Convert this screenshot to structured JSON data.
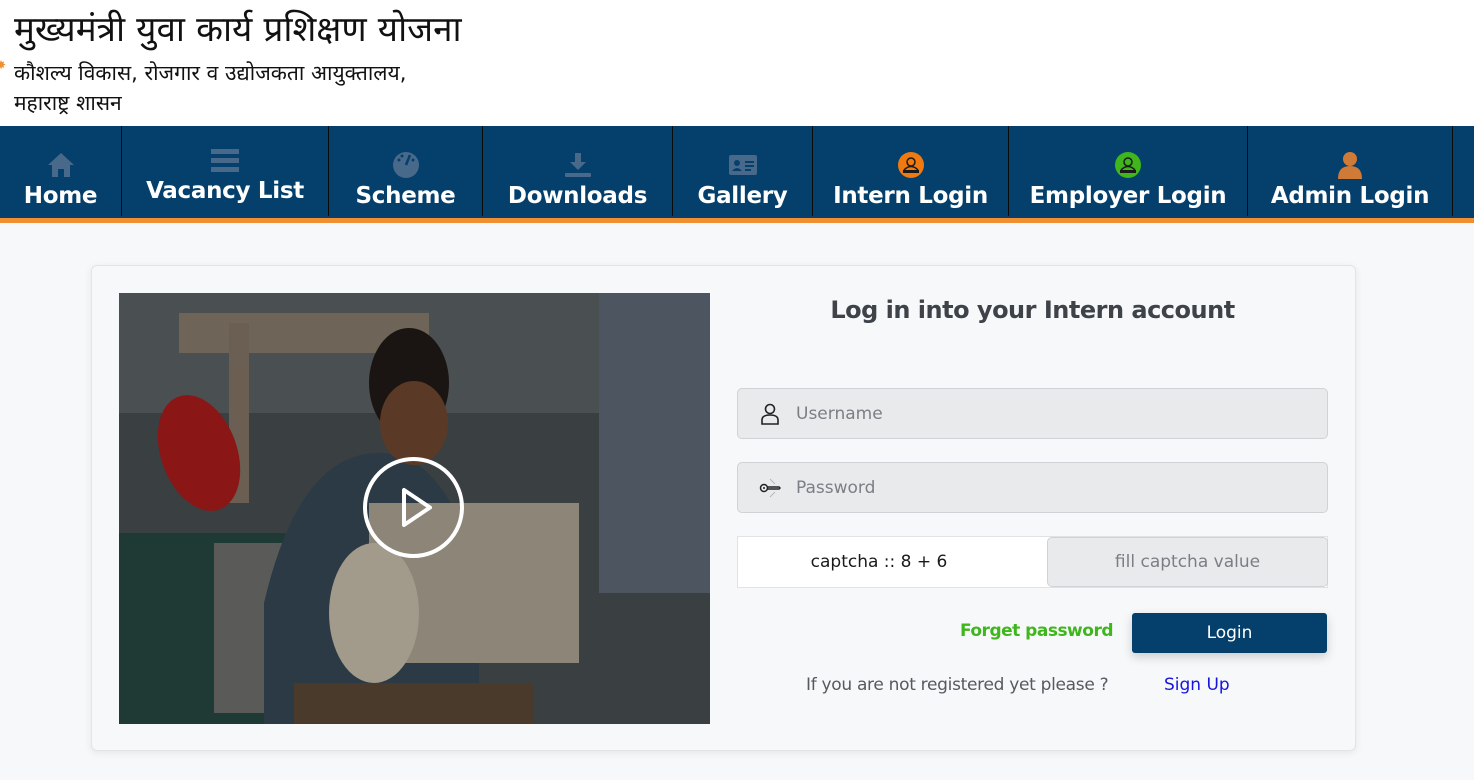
{
  "header": {
    "title": "मुख्यमंत्री युवा कार्य प्रशिक्षण योजना",
    "subtitle_line1": "कौशल्य विकास, रोजगार व उद्योजकता आयुक्तालय,",
    "subtitle_line2": "महाराष्ट्र शासन"
  },
  "nav": {
    "items": [
      {
        "label": "Home",
        "icon": "home-icon"
      },
      {
        "label": "Vacancy List",
        "icon": "list-icon"
      },
      {
        "label": "Scheme",
        "icon": "dashboard-icon"
      },
      {
        "label": "Downloads",
        "icon": "download-icon"
      },
      {
        "label": "Gallery",
        "icon": "id-card-icon"
      },
      {
        "label": "Intern Login",
        "icon": "intern-user-icon"
      },
      {
        "label": "Employer Login",
        "icon": "employer-user-icon"
      },
      {
        "label": "Admin Login",
        "icon": "admin-user-icon"
      }
    ]
  },
  "colors": {
    "nav_bg": "#05406c",
    "nav_accent": "#ef8f2f",
    "intern_icon": "#f07a10",
    "employer_icon": "#3fb61c",
    "admin_icon": "#d07a38",
    "forget_link": "#3fb61c",
    "signup_link": "#1515e0",
    "button_bg": "#05406c"
  },
  "login": {
    "title": "Log in into your Intern account",
    "username_placeholder": "Username",
    "password_placeholder": "Password",
    "captcha_label": "captcha :: 8 + 6",
    "captcha_placeholder": "fill captcha value",
    "forget_password": "Forget password",
    "login_button": "Login",
    "register_prompt": "If you are not registered yet please ?",
    "signup_link": "Sign Up"
  },
  "video": {
    "play_icon": "play-icon"
  }
}
